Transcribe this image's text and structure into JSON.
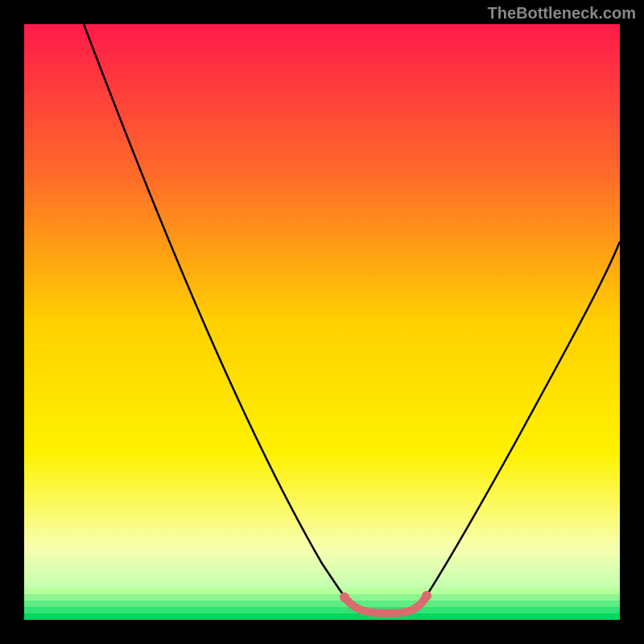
{
  "watermark": "TheBottleneck.com",
  "chart_data": {
    "type": "line",
    "title": "",
    "xlabel": "",
    "ylabel": "",
    "xlim": [
      0,
      100
    ],
    "ylim": [
      0,
      100
    ],
    "background_gradient": {
      "top": "#ff1a4a",
      "upper_mid": "#ff7a00",
      "mid": "#ffe000",
      "lower_mid": "#f5ff80",
      "bottom": "#00e060"
    },
    "series": [
      {
        "name": "curve-left",
        "x": [
          10,
          20,
          30,
          40,
          50,
          55
        ],
        "y": [
          100,
          78,
          55,
          33,
          10,
          3
        ],
        "color": "#000000"
      },
      {
        "name": "curve-right",
        "x": [
          66,
          72,
          80,
          88,
          96,
          100
        ],
        "y": [
          3,
          10,
          25,
          42,
          58,
          65
        ],
        "color": "#000000"
      },
      {
        "name": "highlight-segment",
        "x": [
          54,
          56,
          58,
          60,
          62,
          64,
          66,
          67
        ],
        "y": [
          5,
          2.5,
          1.8,
          1.6,
          1.6,
          1.8,
          2.5,
          5
        ],
        "color": "#d96d6d",
        "thick": true
      }
    ]
  }
}
